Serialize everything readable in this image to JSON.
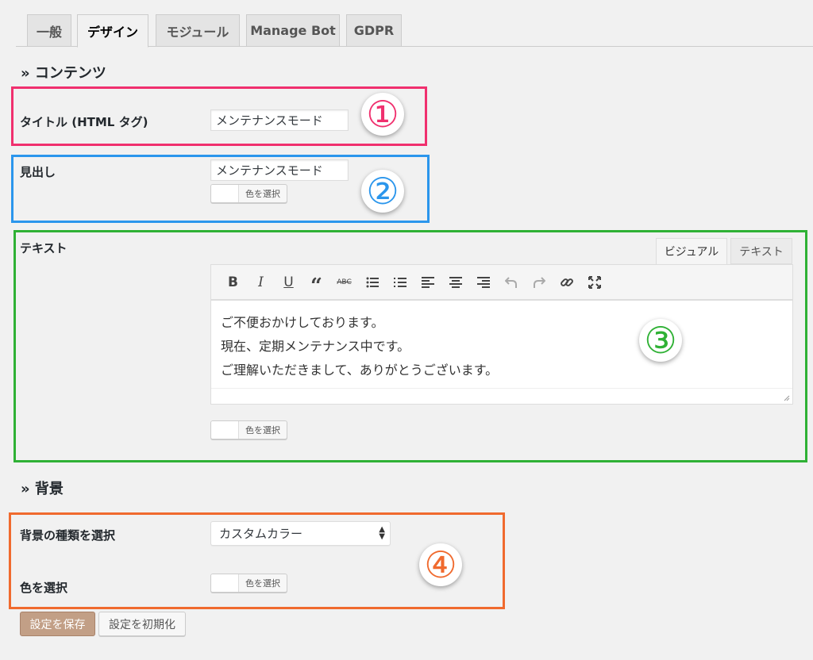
{
  "tabs": [
    {
      "label": "一般",
      "active": false
    },
    {
      "label": "デザイン",
      "active": true
    },
    {
      "label": "モジュール",
      "active": false
    },
    {
      "label": "Manage Bot",
      "active": false
    },
    {
      "label": "GDPR",
      "active": false
    }
  ],
  "contents_section": {
    "title": "» コンテンツ"
  },
  "title_field": {
    "label": "タイトル (HTML タグ)",
    "value": "メンテナンスモード"
  },
  "heading_field": {
    "label": "見出し",
    "value": "メンテナンスモード",
    "color_button": "色を選択"
  },
  "text_field": {
    "label": "テキスト",
    "editor_tabs": [
      "ビジュアル",
      "テキスト"
    ],
    "toolbar": [
      "bold-icon",
      "italic-icon",
      "underline-icon",
      "blockquote-icon",
      "strikethrough-icon",
      "bullet-list-icon",
      "numbered-list-icon",
      "align-left-icon",
      "align-center-icon",
      "align-right-icon",
      "undo-icon",
      "redo-icon",
      "link-icon",
      "fullscreen-icon"
    ],
    "lines": [
      "ご不便おかけしております。",
      "現在、定期メンテナンス中です。",
      "ご理解いただきまして、ありがとうございます。"
    ],
    "color_button": "色を選択"
  },
  "background_section": {
    "title": "» 背景"
  },
  "bg_type": {
    "label": "背景の種類を選択",
    "value": "カスタムカラー"
  },
  "bg_color": {
    "label": "色を選択",
    "color_button": "色を選択"
  },
  "buttons": {
    "save": "設定を保存",
    "reset": "設定を初期化"
  },
  "annotations": [
    {
      "number": "①",
      "color": "#f0306e"
    },
    {
      "number": "②",
      "color": "#2b96ec"
    },
    {
      "number": "③",
      "color": "#2fb135"
    },
    {
      "number": "④",
      "color": "#f06a2e"
    }
  ]
}
